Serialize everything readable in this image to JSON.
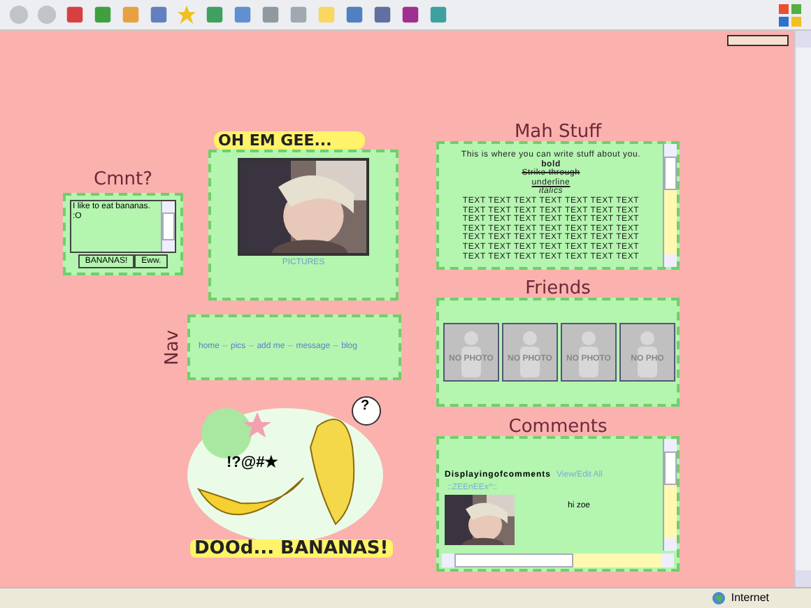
{
  "comment_box": {
    "heading": "Cmnt?",
    "value": "I like to eat bananas. :O",
    "buttons": [
      "BANANAS!",
      "Eww."
    ]
  },
  "photo_panel": {
    "heading": "OH EM GEE...",
    "link": "PICTURES"
  },
  "nav": {
    "heading": "Nav",
    "items": [
      {
        "kind": "link",
        "text": "home"
      },
      {
        "kind": "sep",
        "text": "--"
      },
      {
        "kind": "link",
        "text": "pics"
      },
      {
        "kind": "sep",
        "text": "--"
      },
      {
        "kind": "link",
        "text": "add me"
      },
      {
        "kind": "sep",
        "text": "--"
      },
      {
        "kind": "link",
        "text": "message"
      },
      {
        "kind": "sep",
        "text": "--"
      },
      {
        "kind": "link",
        "text": "blog"
      }
    ]
  },
  "banner": {
    "bubble": "?",
    "symbols": "!?@#★",
    "caption": "DOOd... BANANAS!"
  },
  "about": {
    "heading": "Mah Stuff",
    "intro": "This is where you can write stuff about you.",
    "styled": [
      {
        "kind": "bold",
        "text": "bold"
      },
      {
        "kind": "strike",
        "text": "Strike through"
      },
      {
        "kind": "underline",
        "text": "underline"
      },
      {
        "kind": "italic",
        "text": "italics"
      }
    ],
    "lines": [
      "TEXT TEXT TEXT TEXT TEXT TEXT TEXT",
      "TEXT TEXT TEXT TEXT TEXT TEXT TEXT",
      "TEXT TEXT TEXT TEXT TEXT TEXT TEXT",
      "TEXT TEXT TEXT TEXT TEXT TEXT TEXT",
      "TEXT TEXT TEXT TEXT TEXT TEXT TEXT",
      "TEXT TEXT TEXT TEXT TEXT TEXT TEXT",
      "TEXT TEXT TEXT TEXT TEXT TEXT TEXT"
    ]
  },
  "friends": {
    "heading": "Friends",
    "items": [
      {
        "label": "NO PHOTO"
      },
      {
        "label": "NO PHOTO"
      },
      {
        "label": "NO PHOTO"
      },
      {
        "label": "NO PHO"
      }
    ]
  },
  "comments": {
    "heading": "Comments",
    "title": "Displayingofcomments",
    "link": "View/Edit All",
    "entries": [
      {
        "author": "::ZEEnEEx^::",
        "text": "hi zoe"
      }
    ]
  },
  "status_bar": {
    "zone": "Internet"
  }
}
